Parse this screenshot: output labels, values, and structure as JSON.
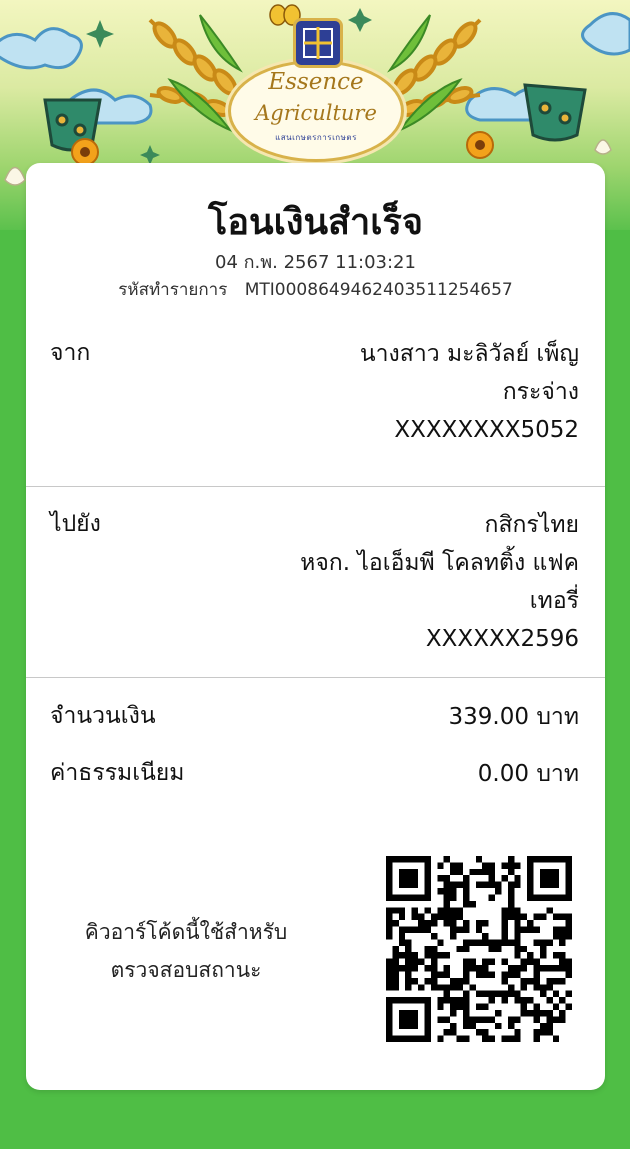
{
  "banner": {
    "logo_line1": "Essence",
    "logo_line2": "Agriculture",
    "logo_sub": "แสนเกษตรการเกษตร"
  },
  "receipt": {
    "title": "โอนเงินสำเร็จ",
    "datetime": "04 ก.พ. 2567 11:03:21",
    "ref_label": "รหัสทำรายการ",
    "ref_value": "MTI000864946240351125465​7",
    "from": {
      "label": "จาก",
      "name_line1": "นางสาว มะลิวัลย์ เพ็ญ",
      "name_line2": "กระจ่าง",
      "account": "XXXXXXXX5052"
    },
    "to": {
      "label": "ไปยัง",
      "bank": "กสิกรไทย",
      "name_line1": "หจก. ไอเอ็มพี โคลทติ้ง แฟค",
      "name_line2": "เทอรี่",
      "account": "XXXXXX2596"
    },
    "amount": {
      "label": "จำนวนเงิน",
      "value": "339.00 บาท"
    },
    "fee": {
      "label": "ค่าธรรมเนียม",
      "value": "0.00 บาท"
    },
    "qr_caption_line1": "คิวอาร์โค้ดนี้ใช้สำหรับ",
    "qr_caption_line2": "ตรวจสอบสถานะ"
  },
  "colors": {
    "background": "#4fbe45",
    "card": "#ffffff",
    "logo_blue": "#2d3f95",
    "logo_gold": "#a5771c"
  }
}
